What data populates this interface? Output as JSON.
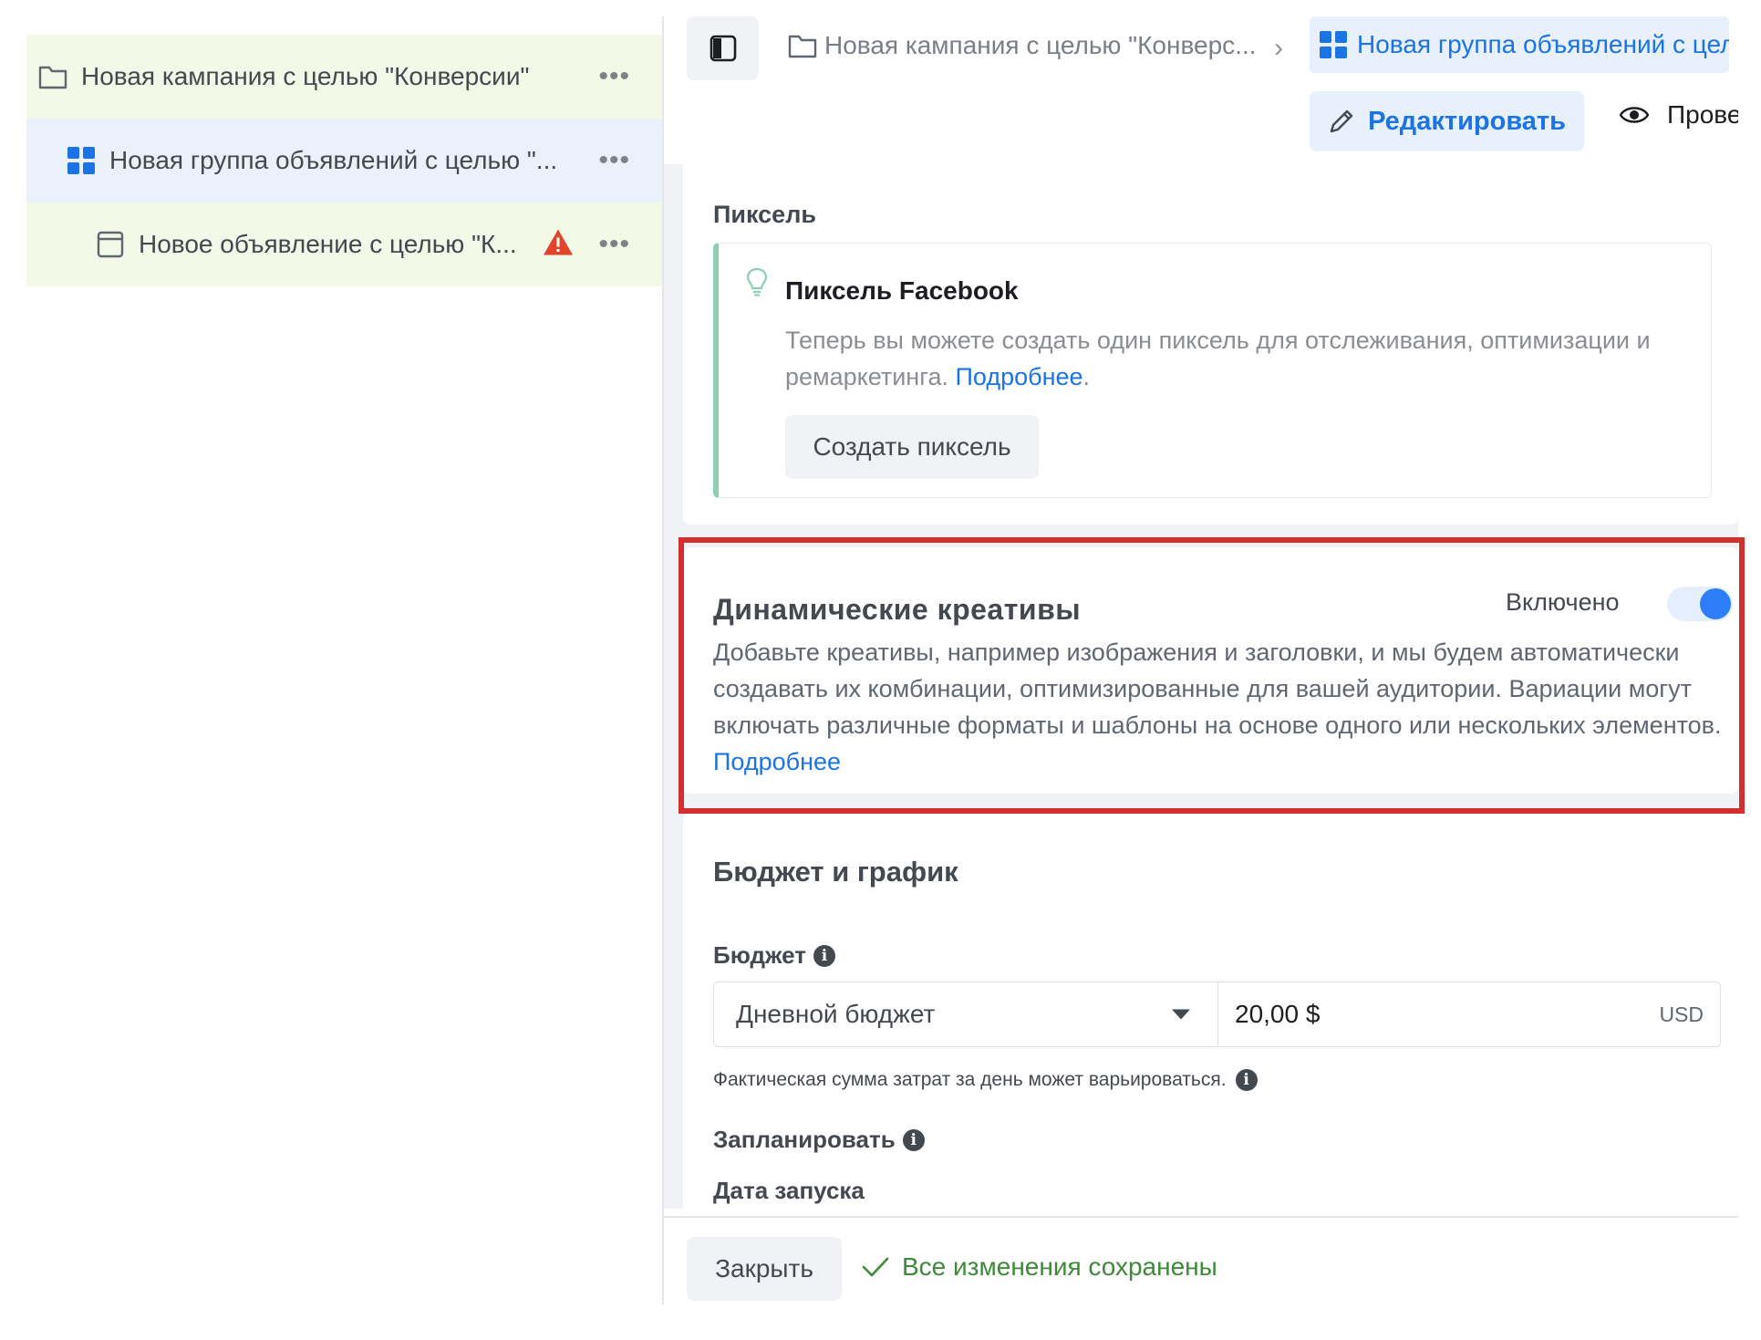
{
  "tree": {
    "items": [
      {
        "label": "Новая кампания с целью \"Конверсии\"",
        "icon": "folder-icon"
      },
      {
        "label": "Новая группа объявлений с целью \"...",
        "icon": "grid-icon"
      },
      {
        "label": "Новое объявление с целью \"К...",
        "icon": "ad-icon",
        "warning": true
      }
    ],
    "more": "•••"
  },
  "breadcrumb": {
    "campaign": "Новая кампания с целью \"Конверс...",
    "separator": "›",
    "adset": "Новая группа объявлений с целью \"Конверсии\""
  },
  "actions": {
    "edit": "Редактировать",
    "review": "Проверить"
  },
  "pixel": {
    "section_title": "Пиксель",
    "box_title": "Пиксель Facebook",
    "text": "Теперь вы можете создать один пиксель для отслеживания, оптимизации и ремаркетинга.",
    "link": "Подробнее",
    "period": ".",
    "button": "Создать пиксель"
  },
  "dynamic": {
    "title": "Динамические креативы",
    "toggle_label": "Включено",
    "toggle_on": true,
    "text": "Добавьте креативы, например изображения и заголовки, и мы будем автоматически создавать их комбинации, оптимизированные для вашей аудитории. Вариации могут включать различные форматы и шаблоны на основе одного или нескольких элементов.",
    "link": "Подробнее"
  },
  "budget": {
    "title": "Бюджет и график",
    "budget_label": "Бюджет",
    "budget_type": "Дневной бюджет",
    "amount": "20,00 $",
    "currency": "USD",
    "note": "Фактическая сумма затрат за день может варьироваться.",
    "schedule_label": "Запланировать",
    "launch_label": "Дата запуска"
  },
  "footer": {
    "close": "Закрыть",
    "status": "Все изменения сохранены"
  },
  "colors": {
    "accent": "#1b74e4",
    "highlight": "#d32f2f",
    "success": "#3f8a3a",
    "warning": "#e0452b"
  }
}
